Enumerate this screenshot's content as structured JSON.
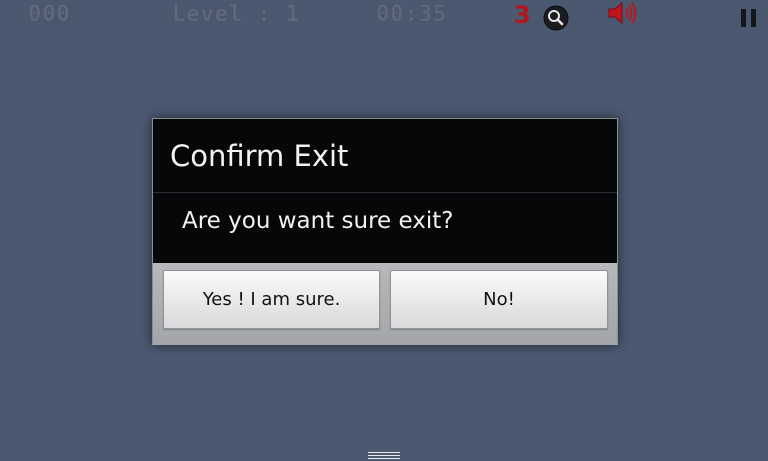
{
  "hud": {
    "score": "000",
    "level": "Level : 1",
    "timer": "00:35",
    "hint_count": "3",
    "icons": {
      "hint": "magnifier-icon",
      "sound": "speaker-icon",
      "pause": "pause-icon"
    }
  },
  "dialog": {
    "title": "Confirm Exit",
    "message": "Are you want sure exit?",
    "yes_label": "Yes ! I am sure.",
    "no_label": "No!"
  },
  "colors": {
    "background": "#4a5870",
    "hud_text": "#5e6878",
    "hint_count": "#b8141c",
    "sound_icon": "#b8141c",
    "dialog_bg": "#060708",
    "dialog_text": "#f2f2f2"
  }
}
